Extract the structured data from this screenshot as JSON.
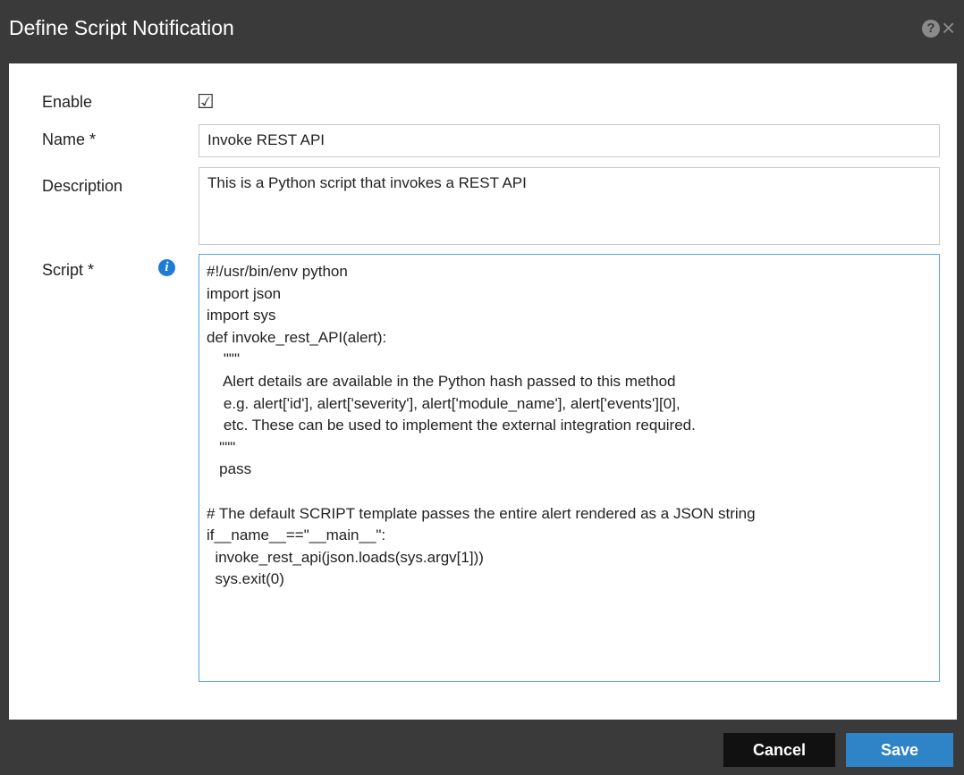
{
  "window": {
    "title": "Define Script Notification",
    "help_symbol": "?",
    "close_symbol": "×"
  },
  "form": {
    "enable_label": "Enable",
    "enable_checked": true,
    "enable_symbol": "☑",
    "name_label": "Name *",
    "name_value": "Invoke REST API",
    "description_label": "Description",
    "description_value": "This is a Python script that invokes a REST API",
    "script_label": "Script *",
    "script_info_symbol": "i",
    "script_lines": [
      "#!/usr/bin/env python",
      "import json",
      "import sys",
      "def invoke_rest_API(alert):",
      "    \"\"\"",
      "    Alert details are available in the Python hash passed to this method",
      "    e.g. alert['id'], alert['severity'], alert['module_name'], alert['events'][0],",
      "    etc. These can be used to implement the external integration required.",
      "   \"\"\"",
      "   pass",
      "",
      "# The default SCRIPT template passes the entire alert rendered as a JSON string",
      "if__name__==\"__main__\":",
      "  invoke_rest_api(json.loads(sys.argv[1]))",
      "  sys.exit(0)"
    ]
  },
  "footer": {
    "cancel_label": "Cancel",
    "save_label": "Save"
  }
}
